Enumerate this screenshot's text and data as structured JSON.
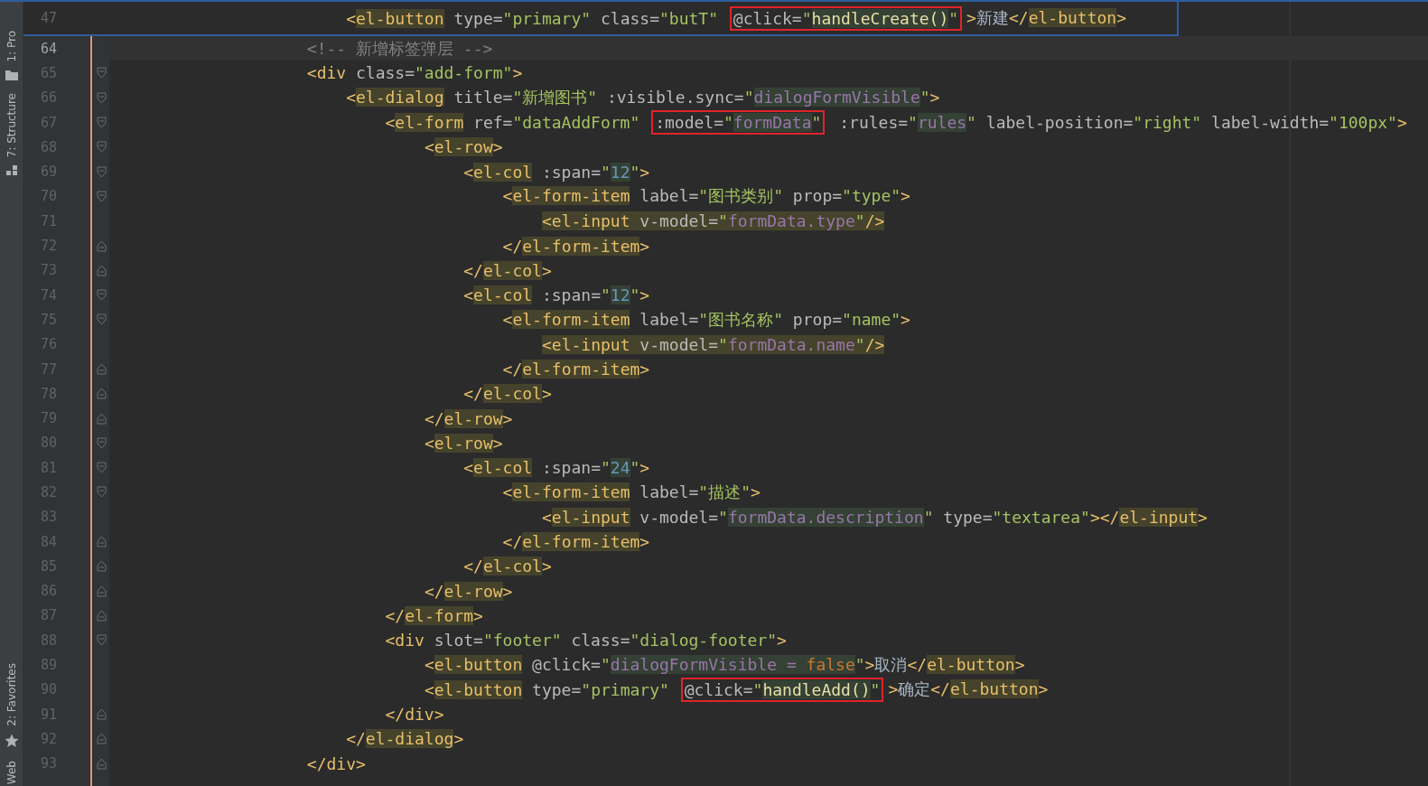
{
  "tool_tabs_top": [
    {
      "label": "1: Pro"
    },
    {
      "label": "7: Structure"
    }
  ],
  "tool_tabs_bottom": [
    {
      "label": "2: Favorites"
    },
    {
      "label": "Web"
    }
  ],
  "sticky_line": {
    "number": "47",
    "segments": [
      {
        "boxed": false,
        "tokens": [
          {
            "kind": "punct",
            "text": "<"
          },
          {
            "kind": "tag-hl",
            "text": "el-button"
          },
          {
            "kind": "attr",
            "text": " type="
          },
          {
            "kind": "string",
            "text": "\"primary\""
          },
          {
            "kind": "attr",
            "text": " class="
          },
          {
            "kind": "string",
            "text": "\"butT\" "
          }
        ]
      },
      {
        "boxed": true,
        "tokens": [
          {
            "kind": "attr",
            "text": "@click="
          },
          {
            "kind": "string",
            "text": "\""
          },
          {
            "kind": "call-hl",
            "text": "handleCreate()"
          },
          {
            "kind": "string",
            "text": "\""
          }
        ]
      },
      {
        "boxed": false,
        "tokens": [
          {
            "kind": "punct",
            "text": ">"
          },
          {
            "kind": "text",
            "text": "新建"
          },
          {
            "kind": "punct",
            "text": "</"
          },
          {
            "kind": "tag-hl",
            "text": "el-button"
          },
          {
            "kind": "punct",
            "text": ">"
          }
        ]
      }
    ]
  },
  "lines": [
    {
      "number": "64",
      "current": true,
      "fold_start": false,
      "fold_end": false,
      "segments": [
        {
          "boxed": false,
          "tokens": [
            {
              "kind": "comment",
              "text": "<!-- 新增标签弹层 -->"
            }
          ]
        }
      ]
    },
    {
      "number": "65",
      "current": false,
      "fold_start": true,
      "fold_end": false,
      "segments": [
        {
          "boxed": false,
          "tokens": [
            {
              "kind": "punct",
              "text": "<div"
            },
            {
              "kind": "attr",
              "text": " class="
            },
            {
              "kind": "string",
              "text": "\"add-form\""
            },
            {
              "kind": "punct",
              "text": ">"
            }
          ]
        }
      ],
      "children": [
        {
          "number": "66",
          "current": false,
          "fold_start": true,
          "fold_end": false,
          "segments": [
            {
              "boxed": false,
              "tokens": [
                {
                  "kind": "punct",
                  "text": "<"
                },
                {
                  "kind": "tag-hl",
                  "text": "el-dialog"
                },
                {
                  "kind": "attr",
                  "text": " title="
                },
                {
                  "kind": "string",
                  "text": "\"新增图书\""
                },
                {
                  "kind": "attr",
                  "text": " :visible.sync="
                },
                {
                  "kind": "string",
                  "text": "\""
                },
                {
                  "kind": "ref-hl",
                  "text": "dialogFormVisible"
                },
                {
                  "kind": "string",
                  "text": "\""
                },
                {
                  "kind": "punct",
                  "text": ">"
                }
              ]
            }
          ],
          "children": [
            {
              "number": "67",
              "current": false,
              "fold_start": true,
              "fold_end": false,
              "segments": [
                {
                  "boxed": false,
                  "tokens": [
                    {
                      "kind": "punct",
                      "text": "<"
                    },
                    {
                      "kind": "tag-hl",
                      "text": "el-form"
                    },
                    {
                      "kind": "attr",
                      "text": " ref="
                    },
                    {
                      "kind": "string",
                      "text": "\"dataAddForm\" "
                    }
                  ]
                },
                {
                  "boxed": true,
                  "tokens": [
                    {
                      "kind": "attr",
                      "text": ":model="
                    },
                    {
                      "kind": "string",
                      "text": "\""
                    },
                    {
                      "kind": "ref-hl",
                      "text": "formData"
                    },
                    {
                      "kind": "string",
                      "text": "\""
                    }
                  ]
                },
                {
                  "boxed": false,
                  "tokens": [
                    {
                      "kind": "attr",
                      "text": " :rules="
                    },
                    {
                      "kind": "string",
                      "text": "\""
                    },
                    {
                      "kind": "ref-hl",
                      "text": "rules"
                    },
                    {
                      "kind": "string",
                      "text": "\""
                    },
                    {
                      "kind": "attr",
                      "text": " label-position="
                    },
                    {
                      "kind": "string",
                      "text": "\"right\""
                    },
                    {
                      "kind": "attr",
                      "text": " label-width="
                    },
                    {
                      "kind": "string",
                      "text": "\"100px\""
                    },
                    {
                      "kind": "punct",
                      "text": ">"
                    }
                  ]
                }
              ],
              "children": [
                {
                  "number": "68",
                  "current": false,
                  "fold_start": true,
                  "fold_end": false,
                  "segments": [
                    {
                      "boxed": false,
                      "tokens": [
                        {
                          "kind": "punct",
                          "text": "<"
                        },
                        {
                          "kind": "tag-hl",
                          "text": "el-row"
                        },
                        {
                          "kind": "punct",
                          "text": ">"
                        }
                      ]
                    }
                  ],
                  "children": [
                    {
                      "number": "69",
                      "current": false,
                      "fold_start": true,
                      "fold_end": false,
                      "segments": [
                        {
                          "boxed": false,
                          "tokens": [
                            {
                              "kind": "punct",
                              "text": "<"
                            },
                            {
                              "kind": "tag-hl",
                              "text": "el-col"
                            },
                            {
                              "kind": "attr",
                              "text": " :span="
                            },
                            {
                              "kind": "string",
                              "text": "\""
                            },
                            {
                              "kind": "number-hl",
                              "text": "12"
                            },
                            {
                              "kind": "string",
                              "text": "\""
                            },
                            {
                              "kind": "punct",
                              "text": ">"
                            }
                          ]
                        }
                      ],
                      "children": [
                        {
                          "number": "70",
                          "current": false,
                          "fold_start": true,
                          "fold_end": false,
                          "segments": [
                            {
                              "boxed": false,
                              "tokens": [
                                {
                                  "kind": "punct",
                                  "text": "<"
                                },
                                {
                                  "kind": "tag-hl",
                                  "text": "el-form-item"
                                },
                                {
                                  "kind": "attr",
                                  "text": " label="
                                },
                                {
                                  "kind": "string",
                                  "text": "\"图书类别\""
                                },
                                {
                                  "kind": "attr",
                                  "text": " prop="
                                },
                                {
                                  "kind": "string",
                                  "text": "\"type\""
                                },
                                {
                                  "kind": "punct",
                                  "text": ">"
                                }
                              ]
                            }
                          ],
                          "children": [
                            {
                              "number": "71",
                              "current": false,
                              "fold_start": false,
                              "fold_end": false,
                              "segments": [
                                {
                                  "boxed": false,
                                  "tokens": [
                                    {
                                      "kind": "punct-hl",
                                      "text": "<el-input"
                                    },
                                    {
                                      "kind": "attr-hl",
                                      "text": " v-model="
                                    },
                                    {
                                      "kind": "string-hl",
                                      "text": "\""
                                    },
                                    {
                                      "kind": "ref-olive",
                                      "text": "formData.type"
                                    },
                                    {
                                      "kind": "string-hl",
                                      "text": "\""
                                    },
                                    {
                                      "kind": "punct-hl",
                                      "text": "/>"
                                    }
                                  ]
                                }
                              ]
                            }
                          ]
                        },
                        {
                          "number": "72",
                          "current": false,
                          "fold_start": false,
                          "fold_end": true,
                          "segments": [
                            {
                              "boxed": false,
                              "tokens": [
                                {
                                  "kind": "punct",
                                  "text": "</"
                                },
                                {
                                  "kind": "tag-hl",
                                  "text": "el-form-item"
                                },
                                {
                                  "kind": "punct",
                                  "text": ">"
                                }
                              ]
                            }
                          ]
                        }
                      ]
                    },
                    {
                      "number": "73",
                      "current": false,
                      "fold_start": false,
                      "fold_end": true,
                      "segments": [
                        {
                          "boxed": false,
                          "tokens": [
                            {
                              "kind": "punct",
                              "text": "</"
                            },
                            {
                              "kind": "tag-hl",
                              "text": "el-col"
                            },
                            {
                              "kind": "punct",
                              "text": ">"
                            }
                          ]
                        }
                      ]
                    },
                    {
                      "number": "74",
                      "current": false,
                      "fold_start": true,
                      "fold_end": false,
                      "segments": [
                        {
                          "boxed": false,
                          "tokens": [
                            {
                              "kind": "punct",
                              "text": "<"
                            },
                            {
                              "kind": "tag-hl",
                              "text": "el-col"
                            },
                            {
                              "kind": "attr",
                              "text": " :span="
                            },
                            {
                              "kind": "string",
                              "text": "\""
                            },
                            {
                              "kind": "number-hl",
                              "text": "12"
                            },
                            {
                              "kind": "string",
                              "text": "\""
                            },
                            {
                              "kind": "punct",
                              "text": ">"
                            }
                          ]
                        }
                      ],
                      "children": [
                        {
                          "number": "75",
                          "current": false,
                          "fold_start": true,
                          "fold_end": false,
                          "segments": [
                            {
                              "boxed": false,
                              "tokens": [
                                {
                                  "kind": "punct",
                                  "text": "<"
                                },
                                {
                                  "kind": "tag-hl",
                                  "text": "el-form-item"
                                },
                                {
                                  "kind": "attr",
                                  "text": " label="
                                },
                                {
                                  "kind": "string",
                                  "text": "\"图书名称\""
                                },
                                {
                                  "kind": "attr",
                                  "text": " prop="
                                },
                                {
                                  "kind": "string",
                                  "text": "\"name\""
                                },
                                {
                                  "kind": "punct",
                                  "text": ">"
                                }
                              ]
                            }
                          ],
                          "children": [
                            {
                              "number": "76",
                              "current": false,
                              "fold_start": false,
                              "fold_end": false,
                              "segments": [
                                {
                                  "boxed": false,
                                  "tokens": [
                                    {
                                      "kind": "punct-hl",
                                      "text": "<el-input"
                                    },
                                    {
                                      "kind": "attr-hl",
                                      "text": " v-model="
                                    },
                                    {
                                      "kind": "string-hl",
                                      "text": "\""
                                    },
                                    {
                                      "kind": "ref-olive",
                                      "text": "formData.name"
                                    },
                                    {
                                      "kind": "string-hl",
                                      "text": "\""
                                    },
                                    {
                                      "kind": "punct-hl",
                                      "text": "/>"
                                    }
                                  ]
                                }
                              ]
                            }
                          ]
                        },
                        {
                          "number": "77",
                          "current": false,
                          "fold_start": false,
                          "fold_end": true,
                          "segments": [
                            {
                              "boxed": false,
                              "tokens": [
                                {
                                  "kind": "punct",
                                  "text": "</"
                                },
                                {
                                  "kind": "tag-hl",
                                  "text": "el-form-item"
                                },
                                {
                                  "kind": "punct",
                                  "text": ">"
                                }
                              ]
                            }
                          ]
                        }
                      ]
                    },
                    {
                      "number": "78",
                      "current": false,
                      "fold_start": false,
                      "fold_end": true,
                      "segments": [
                        {
                          "boxed": false,
                          "tokens": [
                            {
                              "kind": "punct",
                              "text": "</"
                            },
                            {
                              "kind": "tag-hl",
                              "text": "el-col"
                            },
                            {
                              "kind": "punct",
                              "text": ">"
                            }
                          ]
                        }
                      ]
                    }
                  ]
                },
                {
                  "number": "79",
                  "current": false,
                  "fold_start": false,
                  "fold_end": true,
                  "segments": [
                    {
                      "boxed": false,
                      "tokens": [
                        {
                          "kind": "punct",
                          "text": "</"
                        },
                        {
                          "kind": "tag-hl",
                          "text": "el-row"
                        },
                        {
                          "kind": "punct",
                          "text": ">"
                        }
                      ]
                    }
                  ]
                },
                {
                  "number": "80",
                  "current": false,
                  "fold_start": true,
                  "fold_end": false,
                  "segments": [
                    {
                      "boxed": false,
                      "tokens": [
                        {
                          "kind": "punct",
                          "text": "<"
                        },
                        {
                          "kind": "tag-hl",
                          "text": "el-row"
                        },
                        {
                          "kind": "punct",
                          "text": ">"
                        }
                      ]
                    }
                  ],
                  "children": [
                    {
                      "number": "81",
                      "current": false,
                      "fold_start": true,
                      "fold_end": false,
                      "segments": [
                        {
                          "boxed": false,
                          "tokens": [
                            {
                              "kind": "punct",
                              "text": "<"
                            },
                            {
                              "kind": "tag-hl",
                              "text": "el-col"
                            },
                            {
                              "kind": "attr",
                              "text": " :span="
                            },
                            {
                              "kind": "string",
                              "text": "\""
                            },
                            {
                              "kind": "number-hl",
                              "text": "24"
                            },
                            {
                              "kind": "string",
                              "text": "\""
                            },
                            {
                              "kind": "punct",
                              "text": ">"
                            }
                          ]
                        }
                      ],
                      "children": [
                        {
                          "number": "82",
                          "current": false,
                          "fold_start": true,
                          "fold_end": false,
                          "segments": [
                            {
                              "boxed": false,
                              "tokens": [
                                {
                                  "kind": "punct",
                                  "text": "<"
                                },
                                {
                                  "kind": "tag-hl",
                                  "text": "el-form-item"
                                },
                                {
                                  "kind": "attr",
                                  "text": " label="
                                },
                                {
                                  "kind": "string",
                                  "text": "\"描述\""
                                },
                                {
                                  "kind": "punct",
                                  "text": ">"
                                }
                              ]
                            }
                          ],
                          "children": [
                            {
                              "number": "83",
                              "current": false,
                              "fold_start": false,
                              "fold_end": false,
                              "segments": [
                                {
                                  "boxed": false,
                                  "tokens": [
                                    {
                                      "kind": "punct",
                                      "text": "<"
                                    },
                                    {
                                      "kind": "tag-hl",
                                      "text": "el-input"
                                    },
                                    {
                                      "kind": "attr",
                                      "text": " v-model="
                                    },
                                    {
                                      "kind": "string",
                                      "text": "\""
                                    },
                                    {
                                      "kind": "ref-hl",
                                      "text": "formData.description"
                                    },
                                    {
                                      "kind": "string",
                                      "text": "\""
                                    },
                                    {
                                      "kind": "attr",
                                      "text": " type="
                                    },
                                    {
                                      "kind": "string",
                                      "text": "\"textarea\""
                                    },
                                    {
                                      "kind": "punct",
                                      "text": "></"
                                    },
                                    {
                                      "kind": "tag-hl",
                                      "text": "el-input"
                                    },
                                    {
                                      "kind": "punct",
                                      "text": ">"
                                    }
                                  ]
                                }
                              ]
                            }
                          ]
                        },
                        {
                          "number": "84",
                          "current": false,
                          "fold_start": false,
                          "fold_end": true,
                          "segments": [
                            {
                              "boxed": false,
                              "tokens": [
                                {
                                  "kind": "punct",
                                  "text": "</"
                                },
                                {
                                  "kind": "tag-hl",
                                  "text": "el-form-item"
                                },
                                {
                                  "kind": "punct",
                                  "text": ">"
                                }
                              ]
                            }
                          ]
                        }
                      ]
                    },
                    {
                      "number": "85",
                      "current": false,
                      "fold_start": false,
                      "fold_end": true,
                      "segments": [
                        {
                          "boxed": false,
                          "tokens": [
                            {
                              "kind": "punct",
                              "text": "</"
                            },
                            {
                              "kind": "tag-hl",
                              "text": "el-col"
                            },
                            {
                              "kind": "punct",
                              "text": ">"
                            }
                          ]
                        }
                      ]
                    }
                  ]
                },
                {
                  "number": "86",
                  "current": false,
                  "fold_start": false,
                  "fold_end": true,
                  "segments": [
                    {
                      "boxed": false,
                      "tokens": [
                        {
                          "kind": "punct",
                          "text": "</"
                        },
                        {
                          "kind": "tag-hl",
                          "text": "el-row"
                        },
                        {
                          "kind": "punct",
                          "text": ">"
                        }
                      ]
                    }
                  ]
                }
              ]
            },
            {
              "number": "87",
              "current": false,
              "fold_start": false,
              "fold_end": true,
              "segments": [
                {
                  "boxed": false,
                  "tokens": [
                    {
                      "kind": "punct",
                      "text": "</"
                    },
                    {
                      "kind": "tag-hl",
                      "text": "el-form"
                    },
                    {
                      "kind": "punct",
                      "text": ">"
                    }
                  ]
                }
              ]
            },
            {
              "number": "88",
              "current": false,
              "fold_start": true,
              "fold_end": false,
              "segments": [
                {
                  "boxed": false,
                  "tokens": [
                    {
                      "kind": "punct",
                      "text": "<div"
                    },
                    {
                      "kind": "attr",
                      "text": " slot="
                    },
                    {
                      "kind": "string",
                      "text": "\"footer\""
                    },
                    {
                      "kind": "attr",
                      "text": " class="
                    },
                    {
                      "kind": "string",
                      "text": "\"dialog-footer\""
                    },
                    {
                      "kind": "punct",
                      "text": ">"
                    }
                  ]
                }
              ],
              "children": [
                {
                  "number": "89",
                  "current": false,
                  "fold_start": false,
                  "fold_end": false,
                  "segments": [
                    {
                      "boxed": false,
                      "tokens": [
                        {
                          "kind": "punct",
                          "text": "<"
                        },
                        {
                          "kind": "tag-hl",
                          "text": "el-button"
                        },
                        {
                          "kind": "attr",
                          "text": " @click="
                        },
                        {
                          "kind": "string",
                          "text": "\""
                        },
                        {
                          "kind": "ref-hl",
                          "text": "dialogFormVisible"
                        },
                        {
                          "kind": "attr-green",
                          "text": " = "
                        },
                        {
                          "kind": "keyword-hl",
                          "text": "false"
                        },
                        {
                          "kind": "string",
                          "text": "\""
                        },
                        {
                          "kind": "punct",
                          "text": ">"
                        },
                        {
                          "kind": "text",
                          "text": "取消"
                        },
                        {
                          "kind": "punct",
                          "text": "</"
                        },
                        {
                          "kind": "tag-hl",
                          "text": "el-button"
                        },
                        {
                          "kind": "punct",
                          "text": ">"
                        }
                      ]
                    }
                  ]
                },
                {
                  "number": "90",
                  "current": false,
                  "fold_start": false,
                  "fold_end": false,
                  "segments": [
                    {
                      "boxed": false,
                      "tokens": [
                        {
                          "kind": "punct",
                          "text": "<"
                        },
                        {
                          "kind": "tag-hl",
                          "text": "el-button"
                        },
                        {
                          "kind": "attr",
                          "text": " type="
                        },
                        {
                          "kind": "string",
                          "text": "\"primary\" "
                        }
                      ]
                    },
                    {
                      "boxed": true,
                      "tokens": [
                        {
                          "kind": "attr",
                          "text": "@click="
                        },
                        {
                          "kind": "string",
                          "text": "\""
                        },
                        {
                          "kind": "call-hl",
                          "text": "handleAdd()"
                        },
                        {
                          "kind": "string",
                          "text": "\""
                        }
                      ]
                    },
                    {
                      "boxed": false,
                      "tokens": [
                        {
                          "kind": "punct",
                          "text": ">"
                        },
                        {
                          "kind": "text",
                          "text": "确定"
                        },
                        {
                          "kind": "punct",
                          "text": "</"
                        },
                        {
                          "kind": "tag-hl",
                          "text": "el-button"
                        },
                        {
                          "kind": "punct",
                          "text": ">"
                        }
                      ]
                    }
                  ]
                }
              ]
            },
            {
              "number": "91",
              "current": false,
              "fold_start": false,
              "fold_end": true,
              "segments": [
                {
                  "boxed": false,
                  "tokens": [
                    {
                      "kind": "punct",
                      "text": "</div>"
                    }
                  ]
                }
              ]
            }
          ]
        },
        {
          "number": "92",
          "current": false,
          "fold_start": false,
          "fold_end": true,
          "segments": [
            {
              "boxed": false,
              "tokens": [
                {
                  "kind": "punct",
                  "text": "</"
                },
                {
                  "kind": "tag-hl",
                  "text": "el-dialog"
                },
                {
                  "kind": "punct",
                  "text": ">"
                }
              ]
            }
          ]
        }
      ]
    },
    {
      "number": "93",
      "current": false,
      "fold_start": false,
      "fold_end": true,
      "segments": [
        {
          "boxed": false,
          "tokens": [
            {
              "kind": "punct",
              "text": "</div>"
            }
          ]
        }
      ]
    }
  ]
}
